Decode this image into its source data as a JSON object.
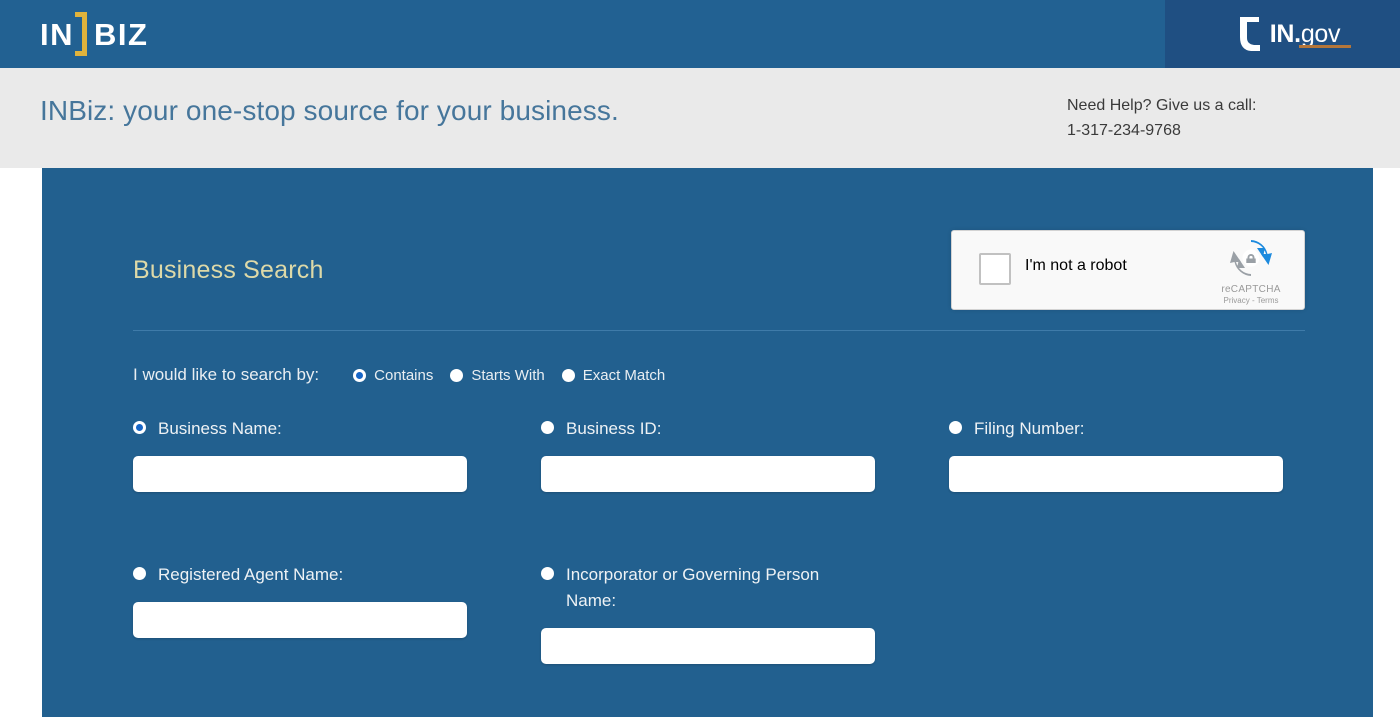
{
  "header": {
    "brand": {
      "prefix": "IN",
      "suffix": "BIZ",
      "bracket_color": "#e0b33c"
    },
    "ingov": {
      "in": "IN.",
      "gov": "gov",
      "icon": "indiana-state-icon",
      "underline_color": "#b4763a"
    },
    "bar_color": "#226192",
    "ingov_panel_color": "#1f4f82"
  },
  "tagline_band": {
    "tagline": "INBiz: your one-stop source for your business.",
    "help_line1": "Need Help? Give us a call:",
    "help_phone": "1-317-234-9768",
    "background": "#eaeaea",
    "tagline_color": "#46769b"
  },
  "panel": {
    "background": "#22608f",
    "section_title": "Business Search",
    "section_title_color": "#ddd9a8"
  },
  "recaptcha": {
    "label": "I'm not a robot",
    "brand": "reCAPTCHA",
    "privacy": "Privacy",
    "separator": "-",
    "terms": "Terms",
    "checked": false,
    "logo_icon": "recaptcha-arrows-icon"
  },
  "search_by": {
    "label": "I would like to search by:",
    "options": [
      {
        "label": "Contains",
        "selected": true
      },
      {
        "label": "Starts With",
        "selected": false
      },
      {
        "label": "Exact Match",
        "selected": false
      }
    ]
  },
  "fields": {
    "row1": [
      {
        "label": "Business Name:",
        "selected": true,
        "value": "",
        "placeholder": ""
      },
      {
        "label": "Business ID:",
        "selected": false,
        "value": "",
        "placeholder": ""
      },
      {
        "label": "Filing Number:",
        "selected": false,
        "value": "",
        "placeholder": ""
      }
    ],
    "row2": [
      {
        "label": "Registered Agent Name:",
        "selected": false,
        "value": "",
        "placeholder": ""
      },
      {
        "label": "Incorporator or Governing Person Name:",
        "selected": false,
        "value": "",
        "placeholder": ""
      }
    ]
  }
}
